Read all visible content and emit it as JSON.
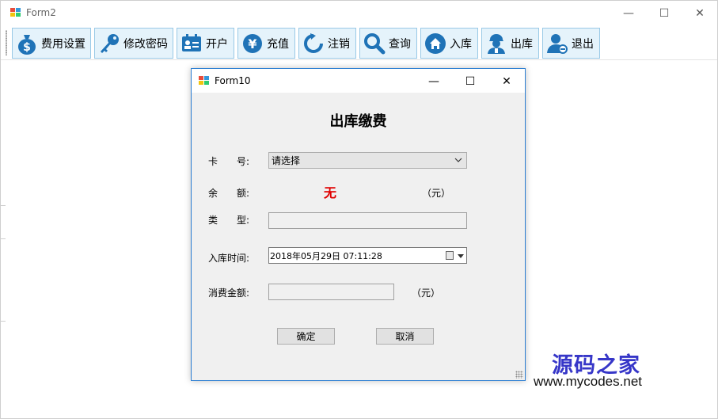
{
  "main_window": {
    "title": "Form2",
    "controls": {
      "minimize": "—",
      "maximize": "☐",
      "close": "✕"
    }
  },
  "toolbar": {
    "buttons": [
      {
        "label": "费用设置",
        "icon": "money-bag-icon"
      },
      {
        "label": "修改密码",
        "icon": "key-icon"
      },
      {
        "label": "开户",
        "icon": "id-card-icon"
      },
      {
        "label": "充值",
        "icon": "yen-coin-icon"
      },
      {
        "label": "注销",
        "icon": "refresh-icon"
      },
      {
        "label": "查询",
        "icon": "magnifier-icon"
      },
      {
        "label": "入库",
        "icon": "home-icon"
      },
      {
        "label": "出库",
        "icon": "worker-icon"
      },
      {
        "label": "退出",
        "icon": "user-remove-icon"
      }
    ]
  },
  "dialog": {
    "title": "Form10",
    "controls": {
      "minimize": "—",
      "maximize": "☐",
      "close": "✕"
    },
    "heading": "出库缴费",
    "fields": {
      "card_label": "卡　　号:",
      "card_value": "请选择",
      "balance_label": "余　　额:",
      "balance_value": "无",
      "balance_unit": "（元）",
      "type_label": "类　　型:",
      "type_value": "",
      "time_label": "入库时间:",
      "time_value": "2018年05月29日  07:11:28",
      "amount_label": "消费金额:",
      "amount_value": "",
      "amount_unit": "（元）"
    },
    "ok_label": "确定",
    "cancel_label": "取消"
  },
  "watermark": {
    "name": "源码之家",
    "url": "www.mycodes.net"
  },
  "colors": {
    "accent_border": "#2d7fd3",
    "button_hover": "#e5f3fb",
    "balance_red": "#e00000",
    "watermark_blue": "#3636c8"
  }
}
